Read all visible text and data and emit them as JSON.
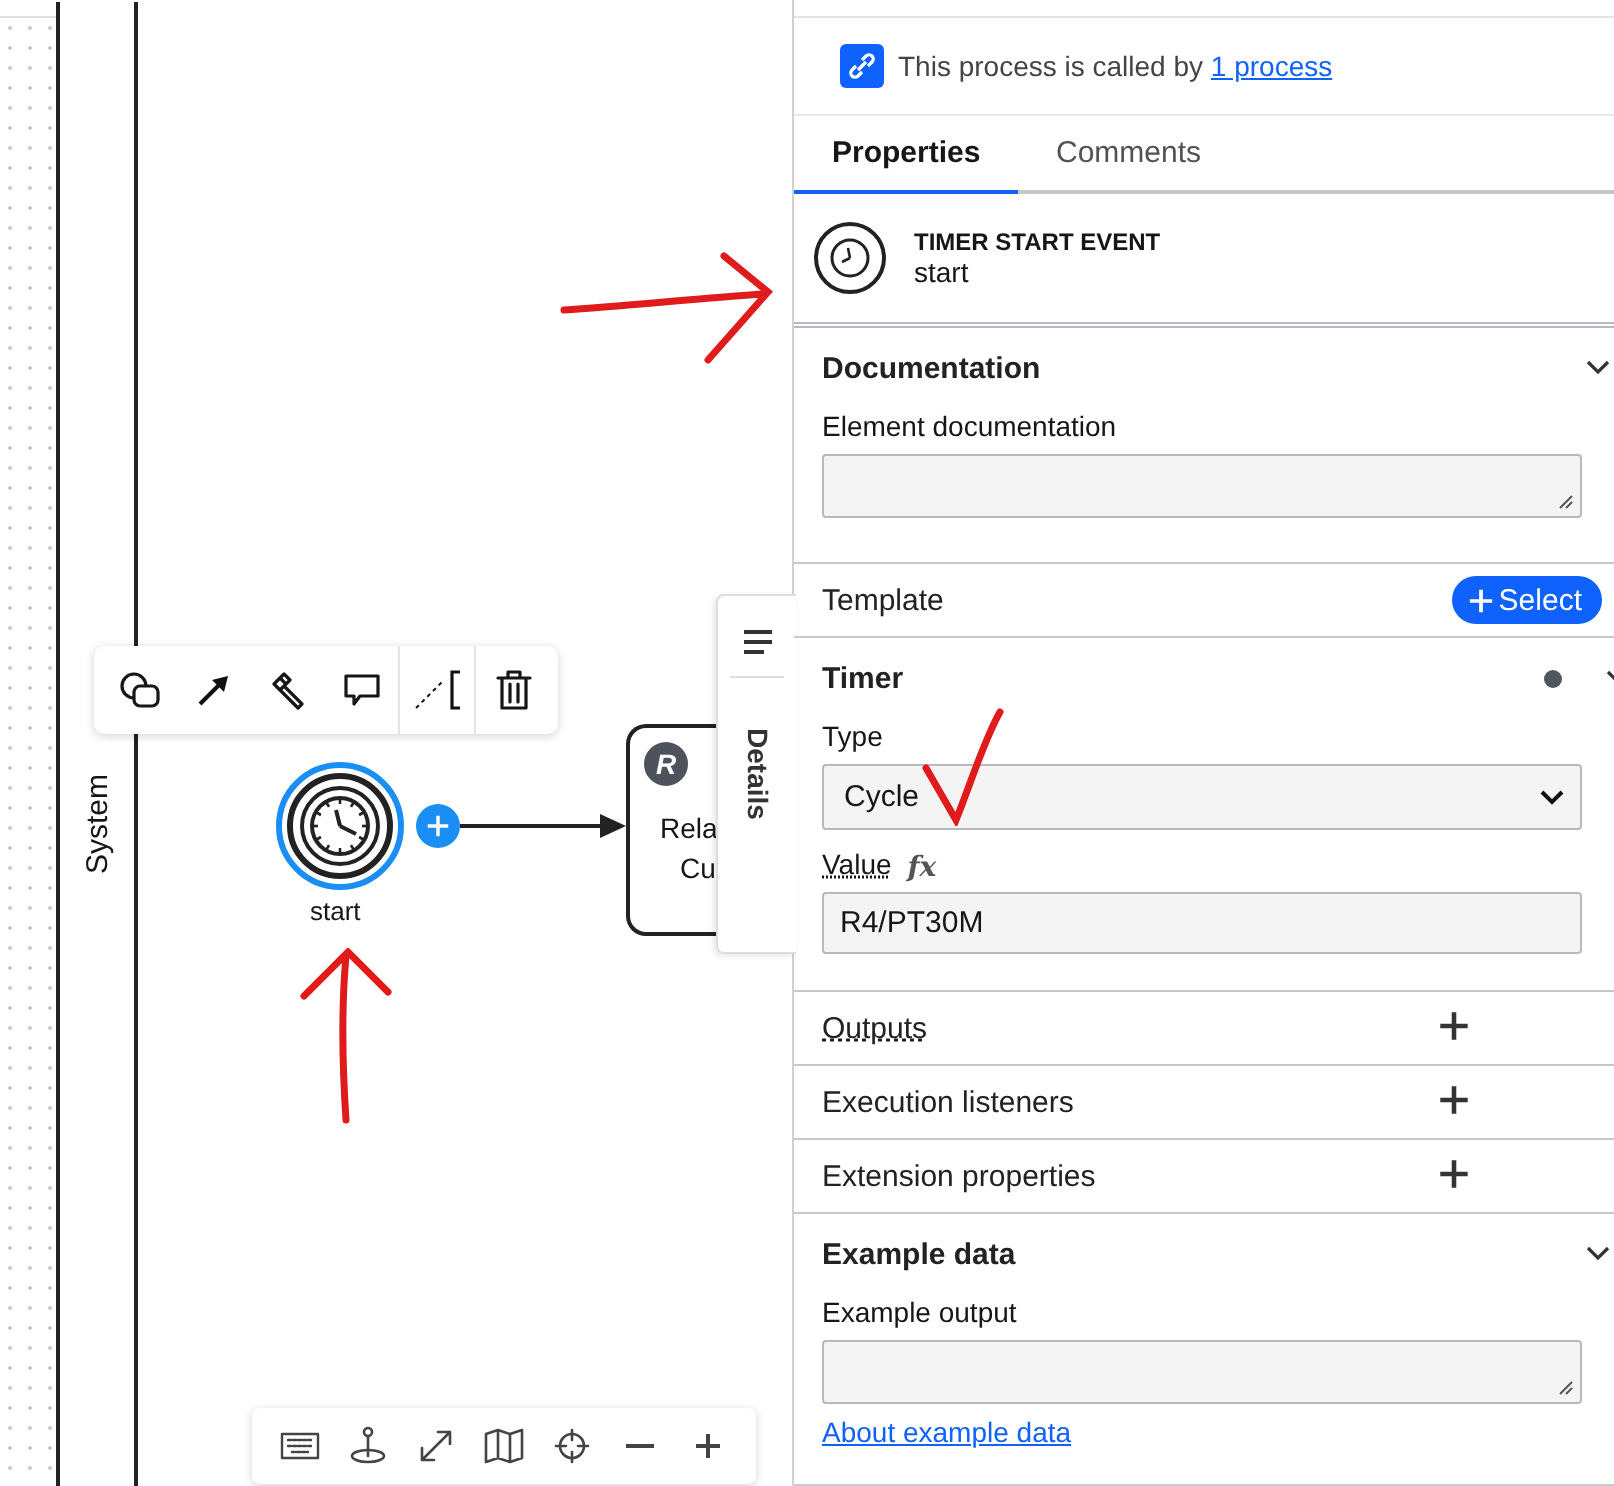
{
  "canvas": {
    "lane_label": "System",
    "start_event": {
      "label": "start",
      "selected": true
    },
    "task": {
      "label_lines": [
        "Rela",
        "Cu"
      ],
      "badge": "R"
    },
    "details_tab": {
      "label": "Details"
    }
  },
  "panel": {
    "notice": {
      "text": "This process is called by",
      "link": "1 process"
    },
    "tabs": [
      {
        "label": "Properties",
        "selected": true
      },
      {
        "label": "Comments",
        "selected": false
      }
    ],
    "element": {
      "type": "TIMER START EVENT",
      "name": "start"
    },
    "sections": [
      {
        "kind": "group",
        "title": "Documentation",
        "expanded": true,
        "fields": [
          {
            "kind": "textarea",
            "label": "Element documentation"
          }
        ]
      },
      {
        "kind": "template",
        "title": "Template",
        "button": "Select"
      },
      {
        "kind": "group",
        "title": "Timer",
        "expanded": true,
        "has_data": true,
        "fields": [
          {
            "kind": "select",
            "label": "Type",
            "value": "Cycle"
          },
          {
            "kind": "input",
            "label": "Value",
            "hint": true,
            "feel": "fx",
            "value": "R4/PT30M"
          }
        ]
      },
      {
        "kind": "list",
        "title": "Outputs",
        "hint": true
      },
      {
        "kind": "list",
        "title": "Execution listeners",
        "hint": false
      },
      {
        "kind": "list",
        "title": "Extension properties",
        "hint": false
      },
      {
        "kind": "group",
        "title": "Example data",
        "expanded": true,
        "fields": [
          {
            "kind": "textarea",
            "label": "Example output"
          },
          {
            "kind": "link",
            "label": "About example data"
          }
        ]
      }
    ]
  }
}
